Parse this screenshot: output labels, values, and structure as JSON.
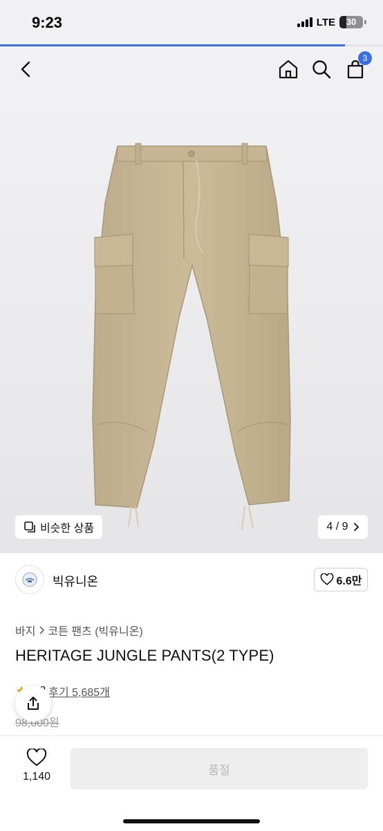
{
  "status_bar": {
    "time": "9:23",
    "network": "LTE",
    "battery": "30",
    "battery_level": 0.3
  },
  "loading": {
    "progress": 0.9
  },
  "nav": {
    "cart_count": "3"
  },
  "gallery": {
    "similar_label": "비슷한 상품",
    "pager": "4 / 9"
  },
  "brand": {
    "name": "빅유니온",
    "likes": "6.6만"
  },
  "breadcrumb": {
    "category": "바지",
    "subcategory": "코튼 팬츠 (빅유니온)"
  },
  "product": {
    "title": "HERITAGE JUNGLE PANTS(2 TYPE)",
    "rating": "4.8",
    "reviews": "후기 5,685개",
    "original_price": "98,000원"
  },
  "bottom": {
    "wish_count": "1,140",
    "buy_label": "품절"
  },
  "colors": {
    "accent": "#3b6fe0",
    "khaki": "#c8b795",
    "khaki_dark": "#a8987a"
  }
}
